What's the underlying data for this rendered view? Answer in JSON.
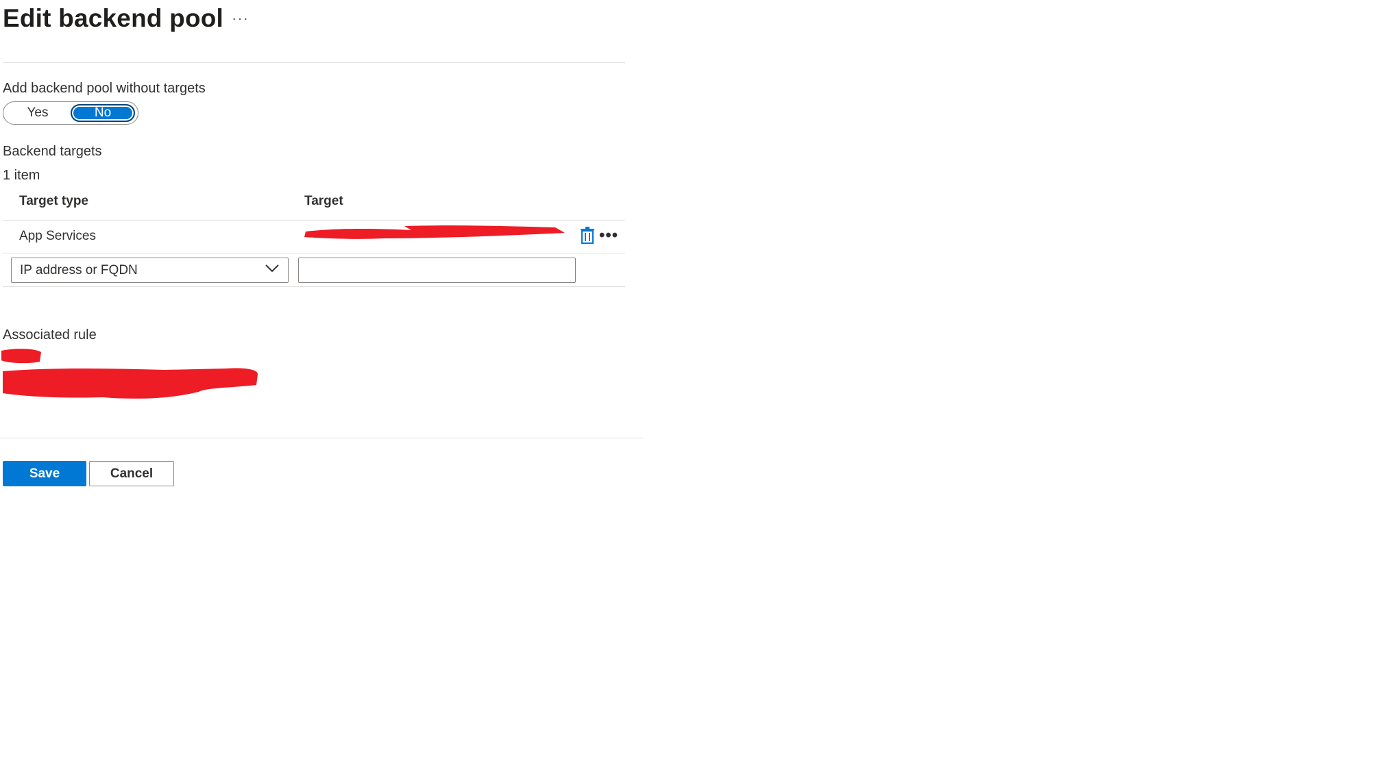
{
  "header": {
    "title": "Edit backend pool",
    "more_label": "···"
  },
  "toggle": {
    "label": "Add backend pool without targets",
    "options": [
      "Yes",
      "No"
    ],
    "selected": "No"
  },
  "targets": {
    "section_label": "Backend targets",
    "count_label": "1 item",
    "columns": [
      "Target type",
      "Target"
    ],
    "rows": [
      {
        "target_type": "App Services",
        "target": ""
      }
    ],
    "new_row": {
      "type_value": "IP address or FQDN",
      "target_value": ""
    },
    "row_more_label": "•••"
  },
  "associated_rule": {
    "label": "Associated rule"
  },
  "footer": {
    "save_label": "Save",
    "cancel_label": "Cancel"
  },
  "colors": {
    "accent": "#0078d4",
    "redaction": "#ee1c25"
  },
  "icons": {
    "delete": "trash-icon",
    "dropdown": "chevron-down-icon",
    "more": "more-icon"
  }
}
